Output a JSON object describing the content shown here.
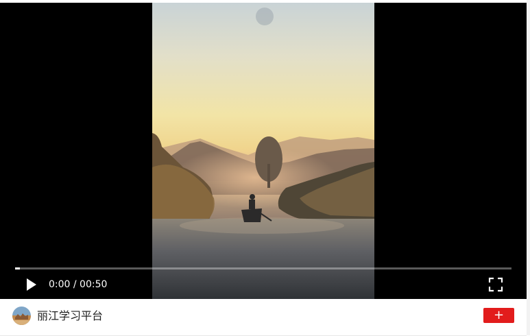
{
  "player": {
    "current_time": "0:00",
    "duration": "00:50",
    "time_text": "0:00 / 00:50",
    "progress": 0.01,
    "play_icon": "play-icon",
    "fullscreen_icon": "fullscreen-icon"
  },
  "footer": {
    "channel_name": "丽江学习平台",
    "follow_label": "+",
    "accent_color": "#e21c1c"
  }
}
